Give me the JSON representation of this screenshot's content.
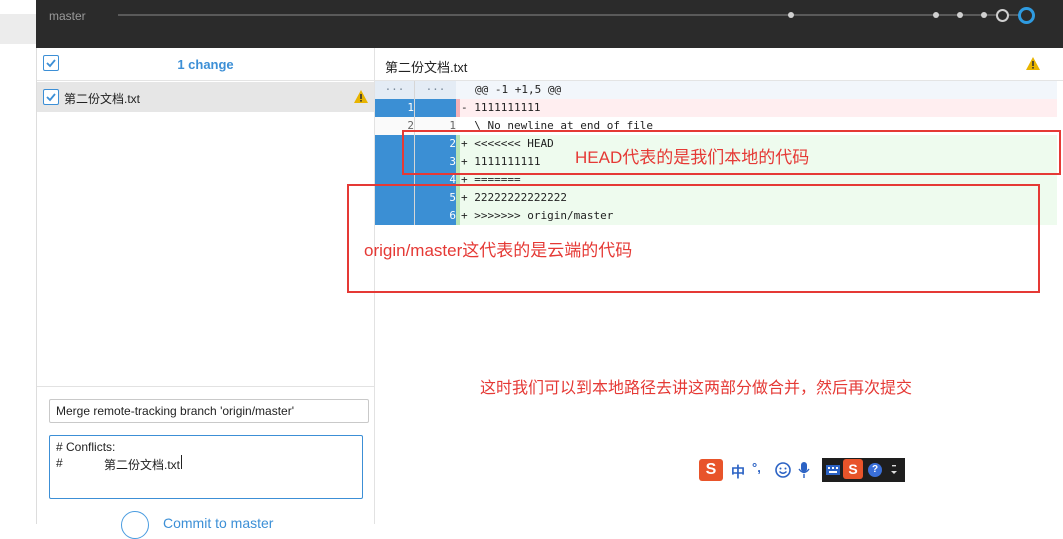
{
  "topbar": {
    "branch": "master"
  },
  "sidebar": {
    "changes_label": "1 change",
    "files": [
      {
        "name": "第二份文档.txt"
      }
    ],
    "commit": {
      "summary": "Merge remote-tracking branch 'origin/master'",
      "description_lines": [
        "# Conflicts:",
        "#",
        "第二份文档.txt"
      ],
      "button_label": "Commit to master"
    }
  },
  "diff": {
    "file_name": "第二份文档.txt",
    "hunk_header": "@@ -1 +1,5 @@",
    "hunk_gutter": "···",
    "rows": [
      {
        "type": "del",
        "old": "1",
        "new": "",
        "text": "- 1111111111"
      },
      {
        "type": "ctx",
        "old": "2",
        "new": "1",
        "text": "  \\ No newline at end of file"
      },
      {
        "type": "add",
        "old": "",
        "new": "2",
        "text": "+ <<<<<<< HEAD"
      },
      {
        "type": "add",
        "old": "",
        "new": "3",
        "text": "+ 1111111111"
      },
      {
        "type": "add",
        "old": "",
        "new": "4",
        "text": "+ ======="
      },
      {
        "type": "add",
        "old": "",
        "new": "5",
        "text": "+ 22222222222222"
      },
      {
        "type": "add",
        "old": "",
        "new": "6",
        "text": "+ >>>>>>> origin/master"
      }
    ]
  },
  "annotations": {
    "head": "HEAD代表的是我们本地的代码",
    "origin": "origin/master这代表的是云端的代码",
    "note": "这时我们可以到本地路径去讲这两部分做合并，然后再次提交"
  },
  "ime": {
    "mode": "中",
    "punct": "°,"
  },
  "colors": {
    "accent": "#3c8fd6",
    "selected_gutter": "#3b8fd4",
    "annotation": "#e53935",
    "warning": "#e8b400"
  }
}
